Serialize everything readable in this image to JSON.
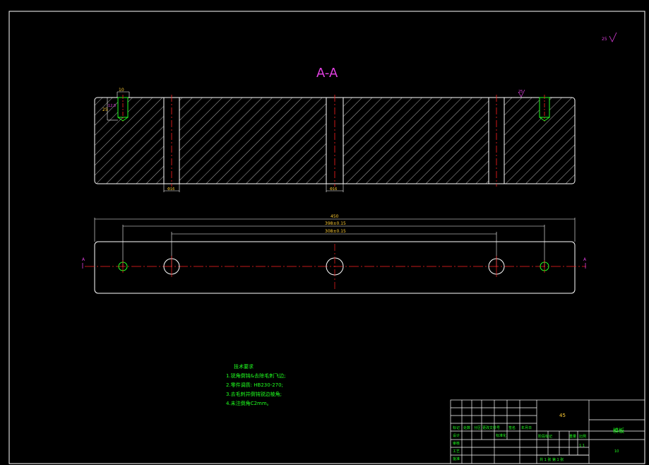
{
  "section_title": "A-A",
  "colors": {
    "background": "#000000",
    "outline": "#ffffff",
    "title": "#e040e0",
    "dimension": "#ffcc33",
    "centerline": "#ff2020",
    "tech_notes": "#20ff20",
    "hole_circle": "#20ff20",
    "roughness": "#e040e0",
    "title_block_text": "#20ff20"
  },
  "roughness": {
    "corner_value": "25",
    "top_right_value": "25",
    "left_hole_value": "12.5"
  },
  "section_view": {
    "hole_depth_label": "25",
    "hole_diameter_label": "10",
    "left_dim_label": "Φ16",
    "center_dim_label": "Φ16"
  },
  "plan_view": {
    "overall_length_label": "450",
    "outer_holes_label": "398±0.15",
    "inner_holes_label": "308±0.15",
    "section_mark": "A"
  },
  "tech_requirements": {
    "heading": "技术要求",
    "items": [
      "1.锐角倒钝&去除毛刺飞边;",
      "2.零件调质: HB230-270;",
      "3.去毛刺并倒钝锐边棱角;",
      "4.未注倒角C2mm。"
    ]
  },
  "title_block": {
    "material": "45",
    "part_name": "模板",
    "labels_top": [
      "标记",
      "处数",
      "分区",
      "更改文件号",
      "签名",
      "年月日"
    ],
    "design": "设计",
    "standard": "标准化",
    "check": "审核",
    "craft": "工艺",
    "approve": "批准",
    "stage_labels": [
      "阶段标记",
      "重量",
      "比例"
    ],
    "scale": "1:1",
    "sheet": "共 1 张 第 1 张",
    "drawing_no": "10"
  }
}
